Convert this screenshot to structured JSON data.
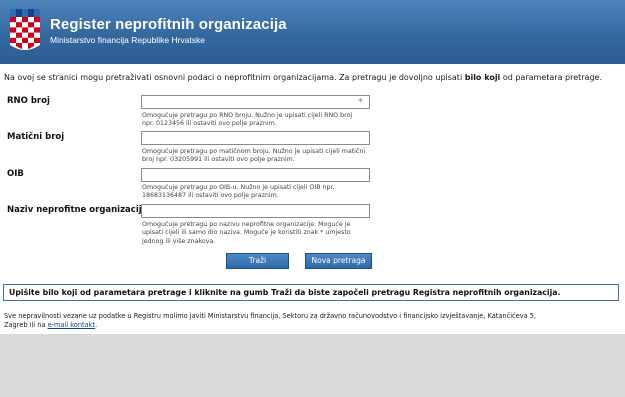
{
  "header": {
    "title": "Register neprofitnih organizacija",
    "subtitle": "Ministarstvo financija Republike Hrvatske",
    "crest_icon": "croatian-coat-of-arms"
  },
  "intro": {
    "text_before": "Na ovoj se stranici mogu pretraživati osnovni podaci o neprofitnim organizacijama. Za pretragu je dovoljno upisati ",
    "text_bold": "bilo koji",
    "text_after": " od parametara pretrage."
  },
  "fields": {
    "rno": {
      "label": "RNO broj",
      "value": "",
      "hint_line1": "Omogućuje pretragu po RNO broju. Nužno je upisati cijeli RNO broj",
      "hint_line2": "npr. 0123456 ili ostaviti ovo polje praznim."
    },
    "maticni": {
      "label": "Matični broj",
      "value": "",
      "hint_line1": "Omogućuje pretragu po matičnom broju. Nužno je upisati cijeli matični",
      "hint_line2": "broj npr. 03205991 ili ostaviti ovo polje praznim."
    },
    "oib": {
      "label": "OIB",
      "value": "",
      "hint_line1": "Omogućuje pretragu po OIB-u. Nužno je upisati cijeli OIB npr.",
      "hint_line2": "18683136487 ili ostaviti ovo polje praznim."
    },
    "naziv": {
      "label": "Naziv neprofitne organizacije",
      "value": "",
      "hint_line1": "Omogućuje pretragu po nazivu neprofitne organizacije. Moguće je",
      "hint_line2": "upisati cijeli ili samo dio naziva. Moguće je koristiti znak * umjesto",
      "hint_line3": "jednog ili više znakova."
    }
  },
  "asterisk": "*",
  "buttons": {
    "search": "Traži",
    "new_search": "Nova pretraga"
  },
  "infobox": "Upišite bilo koji od parametara pretrage i kliknite na gumb Traži da biste započeli pretragu Registra neprofitnih organizacija.",
  "footer": {
    "line1": "Sve nepravilnosti vezane uz podatke u Registru molimo javiti Ministarstvu financija, Sektoru za državno računovodstvo i financijsko izvještavanje, Katančićeva 5,",
    "line2_prefix": "Zagreb ili na ",
    "link": "e-mail kontakt",
    "line2_suffix": "."
  },
  "colors": {
    "header_blue": "#33689f",
    "button_blue": "#2f6aa8",
    "infobox_border": "#3b72b0",
    "background_gray": "#d9d9d9"
  }
}
